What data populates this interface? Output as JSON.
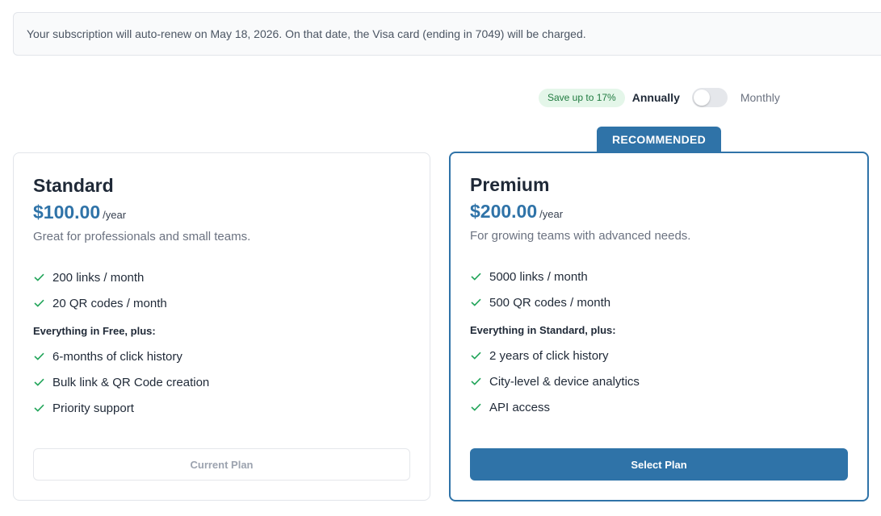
{
  "notice": {
    "text": "Your subscription will auto-renew on May 18, 2026. On that date, the Visa card (ending in 7049) will be charged."
  },
  "billing": {
    "save_badge": "Save up to 17%",
    "annual_label": "Annually",
    "monthly_label": "Monthly",
    "selected": "Annually"
  },
  "recommended_badge": "RECOMMENDED",
  "plans": [
    {
      "name": "Standard",
      "price": "$100.00",
      "period": "/year",
      "description": "Great for professionals and small teams.",
      "features": [
        "200 links / month",
        "20 QR codes / month"
      ],
      "extras_title": "Everything in Free, plus:",
      "extras": [
        "6-months of click history",
        "Bulk link & QR Code creation",
        "Priority support"
      ],
      "button_label": "Current Plan"
    },
    {
      "name": "Premium",
      "price": "$200.00",
      "period": "/year",
      "description": "For growing teams with advanced needs.",
      "features": [
        "5000 links / month",
        "500 QR codes / month"
      ],
      "extras_title": "Everything in Standard, plus:",
      "extras": [
        "2 years of click history",
        "City-level & device analytics",
        "API access"
      ],
      "button_label": "Select Plan"
    }
  ],
  "colors": {
    "accent": "#2f73a8",
    "check": "#22a55a",
    "save_badge_bg": "#e4f6e9",
    "save_badge_text": "#1f7a3f"
  },
  "icons": {
    "feature_bullet": "check-icon"
  }
}
